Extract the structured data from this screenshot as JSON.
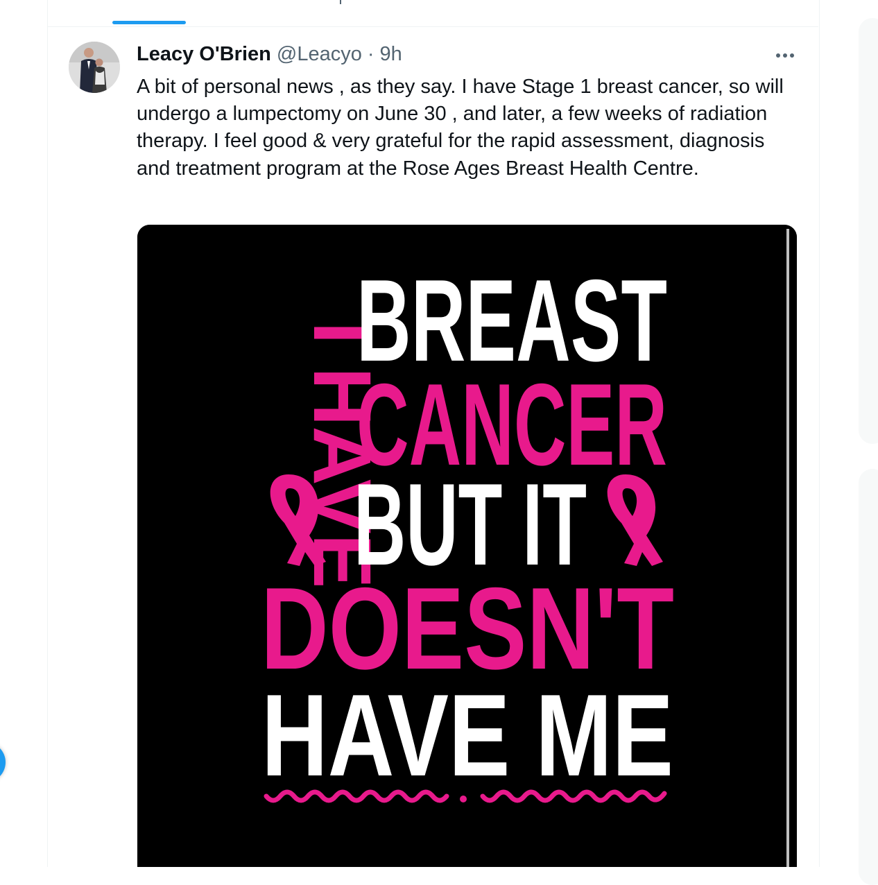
{
  "tweet": {
    "author": {
      "display_name": "Leacy O'Brien",
      "handle": "@Leacyo",
      "separator": "·",
      "time": "9h"
    },
    "text": "A bit of personal news , as they say. I have Stage 1 breast cancer, so will undergo a lumpectomy on June 30 , and later, a few weeks of radiation therapy. I feel good & very grateful for the rapid assessment, diagnosis and treatment program at the Rose Ages Breast Health Centre.",
    "image": {
      "vertical_text": "I HAVE",
      "lines": [
        "BREAST",
        "CANCER",
        "BUT IT",
        "DOESN'T",
        "HAVE ME"
      ],
      "colors": {
        "background": "#000000",
        "pink": "#e81a8c",
        "white": "#ffffff"
      },
      "decorations": [
        "pink-ribbon-icon",
        "pink-ribbon-icon",
        "pink-wave-underline"
      ]
    }
  },
  "colors": {
    "accent": "#1d9bf0",
    "text_primary": "#0f1419",
    "text_secondary": "#536471"
  }
}
